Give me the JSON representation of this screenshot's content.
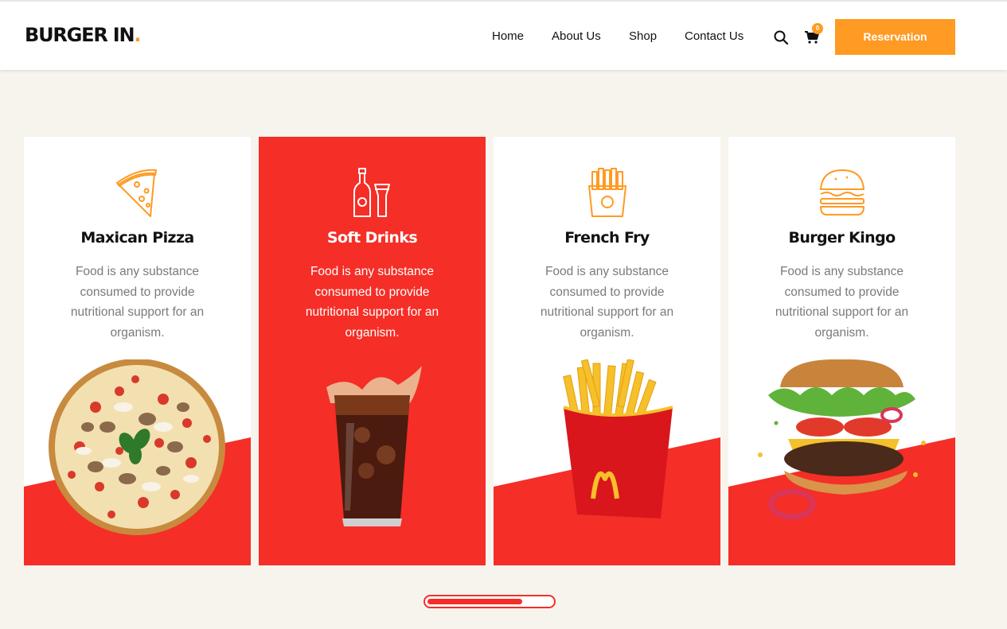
{
  "brand": {
    "name": "BURGER IN",
    "dot": ".",
    "accent": "#ff9a22",
    "red": "#f52e27"
  },
  "nav": {
    "home": "Home",
    "about": "About Us",
    "shop": "Shop",
    "contact": "Contact Us"
  },
  "header": {
    "search_icon": "search-icon",
    "cart_icon": "cart-icon",
    "cart_count": "0",
    "reservation_label": "Reservation"
  },
  "cards": [
    {
      "title": "Maxican Pizza",
      "desc": "Food is any substance consumed to provide nutritional support for an organism.",
      "icon": "pizza-slice-icon",
      "image": "pizza-image"
    },
    {
      "title": "Soft Drinks",
      "desc": "Food is any substance consumed to provide nutritional support for an organism.",
      "icon": "drinks-icon",
      "image": "cola-glass-image"
    },
    {
      "title": "French Fry",
      "desc": "Food is any substance consumed to provide nutritional support for an organism.",
      "icon": "fries-icon",
      "image": "fries-box-image"
    },
    {
      "title": "Burger Kingo",
      "desc": "Food is any substance consumed to provide nutritional support for an organism.",
      "icon": "burger-icon",
      "image": "burger-image"
    }
  ],
  "slider": {
    "progress": 0.76
  }
}
